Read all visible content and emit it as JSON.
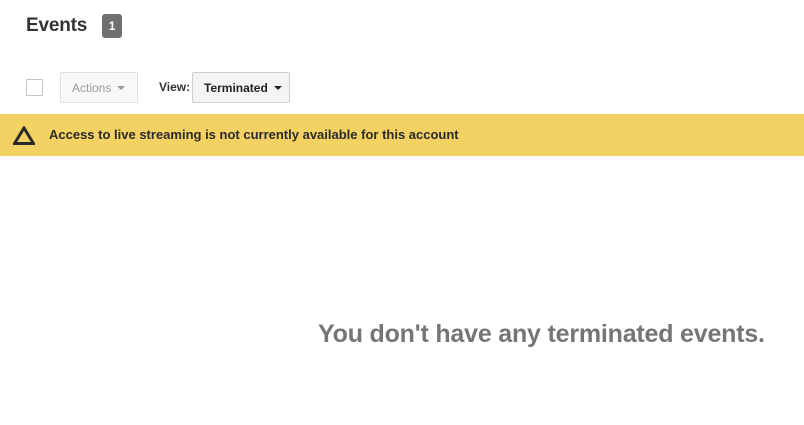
{
  "header": {
    "title": "Events",
    "count": "1"
  },
  "toolbar": {
    "actions_label": "Actions",
    "view_label": "View:",
    "view_selected": "Terminated"
  },
  "banner": {
    "icon": "warning-triangle-icon",
    "color": "#f3d162",
    "message": "Access to live streaming is not currently available for this account"
  },
  "empty_state": {
    "message": "You don't have any terminated events."
  }
}
